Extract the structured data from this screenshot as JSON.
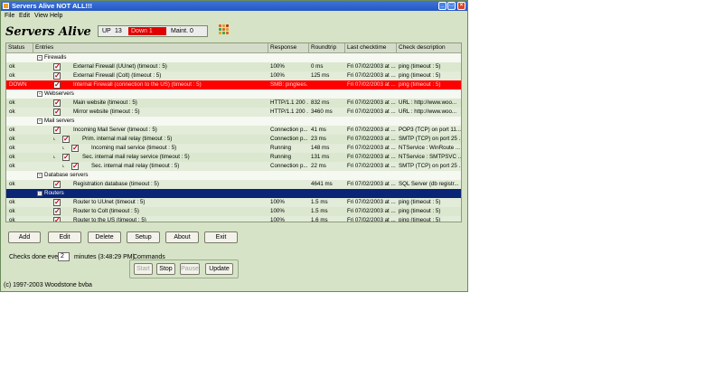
{
  "window": {
    "title": "Servers Alive NOT ALL!!!",
    "min_glyph": "_",
    "max_glyph": "□",
    "close_glyph": "×"
  },
  "menu": [
    "File",
    "Edit",
    "View",
    "Help"
  ],
  "header": {
    "app_title": "Servers Alive",
    "up_label": "UP",
    "up_value": "13",
    "down_label": "Down 1",
    "maint_label": "Maint. 0"
  },
  "table": {
    "columns": [
      "Status",
      "Entries",
      "Response",
      "Roundtrip",
      "Last checktime",
      "Check description"
    ],
    "rows": [
      {
        "kind": "group",
        "status": "",
        "entry": "Firewalls",
        "response": "",
        "roundtrip": "",
        "last": "",
        "desc": ""
      },
      {
        "kind": "item",
        "status": "ok",
        "entry": "External Firewall (UUnet)  (timeout :  5)",
        "response": "100%",
        "roundtrip": "0 ms",
        "last": "Fri 07/02/2003 at ...",
        "desc": "ping   (timeout :  5)"
      },
      {
        "kind": "item",
        "status": "ok",
        "entry": "External Firewall (Colt)  (timeout :  5)",
        "response": "100%",
        "roundtrip": "125 ms",
        "last": "Fri 07/02/2003 at ...",
        "desc": "ping   (timeout :  5)"
      },
      {
        "kind": "error",
        "status": "DOWN",
        "entry": "Internal Firewall (connection to the US)  (timeout :  5)",
        "response": "SMB: pinglees...",
        "roundtrip": "",
        "last": "Fri 07/02/2003 at ...",
        "desc": "ping   (timeout :  5)"
      },
      {
        "kind": "group",
        "status": "",
        "entry": "Webservers",
        "response": "",
        "roundtrip": "",
        "last": "",
        "desc": ""
      },
      {
        "kind": "item",
        "status": "ok",
        "entry": "Main website  (timeout :  5)",
        "response": "HTTP/1.1 200 ...",
        "roundtrip": "832 ms",
        "last": "Fri 07/02/2003 at ...",
        "desc": "URL : http://www.woo..."
      },
      {
        "kind": "item",
        "status": "ok",
        "entry": "Mirror website  (timeout :  5)",
        "response": "HTTP/1.1 200 ...",
        "roundtrip": "3460 ms",
        "last": "Fri 07/02/2003 at ...",
        "desc": "URL : http://www.woo..."
      },
      {
        "kind": "group",
        "status": "",
        "entry": "Mail servers",
        "response": "",
        "roundtrip": "",
        "last": "",
        "desc": ""
      },
      {
        "kind": "item",
        "status": "ok",
        "entry": "Incoming Mail Server  (timeout :  5)",
        "response": "Connection p...",
        "roundtrip": "41 ms",
        "last": "Fri 07/02/2003 at ...",
        "desc": "POP3 (TCP) on port 11..."
      },
      {
        "kind": "item",
        "status": "ok",
        "entry": "Prim. internal mail relay  (timeout :  5)",
        "response": "Connection p...",
        "roundtrip": "23 ms",
        "last": "Fri 07/02/2003 at ...",
        "desc": "SMTP (TCP) on port 25 ..."
      },
      {
        "kind": "item",
        "status": "ok",
        "entry": "Incoming mail service  (timeout :  5)",
        "response": "Running",
        "roundtrip": "148 ms",
        "last": "Fri 07/02/2003 at ...",
        "desc": "NTService : WinRoute ..."
      },
      {
        "kind": "item",
        "status": "ok",
        "entry": "Sec. internal mail relay service  (timeout :  5)",
        "response": "Running",
        "roundtrip": "131 ms",
        "last": "Fri 07/02/2003 at ...",
        "desc": "NTService : SMTPSVC ..."
      },
      {
        "kind": "item",
        "status": "ok",
        "entry": "Sec. internal mail relay  (timeout :  5)",
        "response": "Connection p...",
        "roundtrip": "22 ms",
        "last": "Fri 07/02/2003 at ...",
        "desc": "SMTP (TCP) on port 25 ..."
      },
      {
        "kind": "group",
        "status": "",
        "entry": "Database servers",
        "response": "",
        "roundtrip": "",
        "last": "",
        "desc": ""
      },
      {
        "kind": "item",
        "status": "ok",
        "entry": "Registration database  (timeout :  5)",
        "response": "",
        "roundtrip": "4641 ms",
        "last": "Fri 07/02/2003 at ...",
        "desc": "SQL Server (db registr..."
      },
      {
        "kind": "selected",
        "status": "",
        "entry": "Routers",
        "response": "",
        "roundtrip": "",
        "last": "",
        "desc": ""
      },
      {
        "kind": "item",
        "status": "ok",
        "entry": "Router to UUnet  (timeout :  5)",
        "response": "100%",
        "roundtrip": "1.5 ms",
        "last": "Fri 07/02/2003 at ...",
        "desc": "ping   (timeout :  5)"
      },
      {
        "kind": "item",
        "status": "ok",
        "entry": "Router to Colt  (timeout :  5)",
        "response": "100%",
        "roundtrip": "1.5 ms",
        "last": "Fri 07/02/2003 at ...",
        "desc": "ping   (timeout :  5)"
      },
      {
        "kind": "item",
        "status": "ok",
        "entry": "Router to the US  (timeout :  5)",
        "response": "100%",
        "roundtrip": "1.6 ms",
        "last": "Fri 07/02/2003 at ...",
        "desc": "ping   (timeout :  5)"
      }
    ]
  },
  "buttons": {
    "add": "Add",
    "edit": "Edit",
    "delete": "Delete",
    "setup": "Setup",
    "about": "About",
    "exit": "Exit"
  },
  "checks": {
    "prefix": "Checks done every",
    "interval": "2",
    "suffix": "minutes  (3:48:29 PM)"
  },
  "commands": {
    "label": "Commands",
    "start": "Start",
    "stop": "Stop",
    "pause": "Pause",
    "update": "Update"
  },
  "footer": {
    "copyright": "(c) 1997-2003 Woodstone bvba"
  },
  "colors": {
    "down_row": "#ff0000",
    "selected_row": "#0a2476",
    "window_bg": "#d6e3c6"
  }
}
